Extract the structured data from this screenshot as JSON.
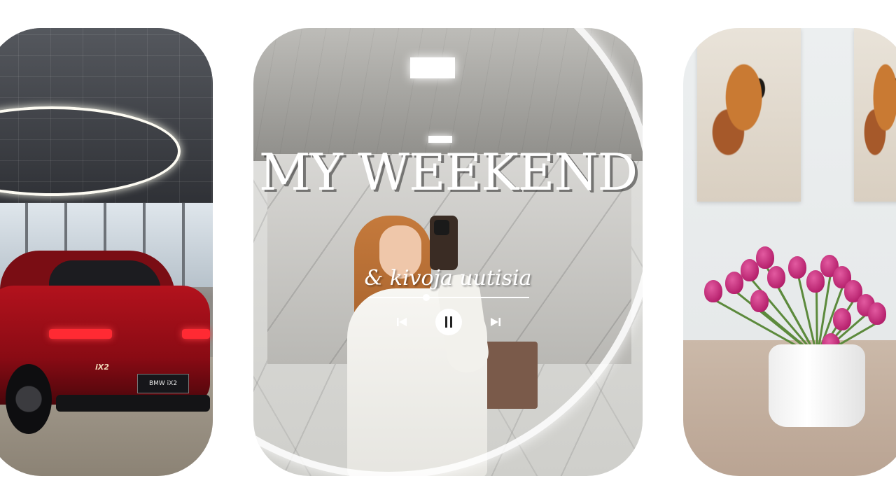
{
  "layout": {
    "title": "MY WEEKEND",
    "subtitle": "& kivoja uutisia"
  },
  "car": {
    "plate_text": "BMW iX2",
    "badge_text": "iX2"
  },
  "player": {
    "progress": 0.36,
    "prev_icon": "skip-previous-icon",
    "pause_icon": "pause-icon",
    "next_icon": "skip-next-icon"
  },
  "colors": {
    "background": "#ffffff",
    "text": "#ffffff",
    "car_red": "#b3121d",
    "tulip_pink": "#c0287a"
  }
}
